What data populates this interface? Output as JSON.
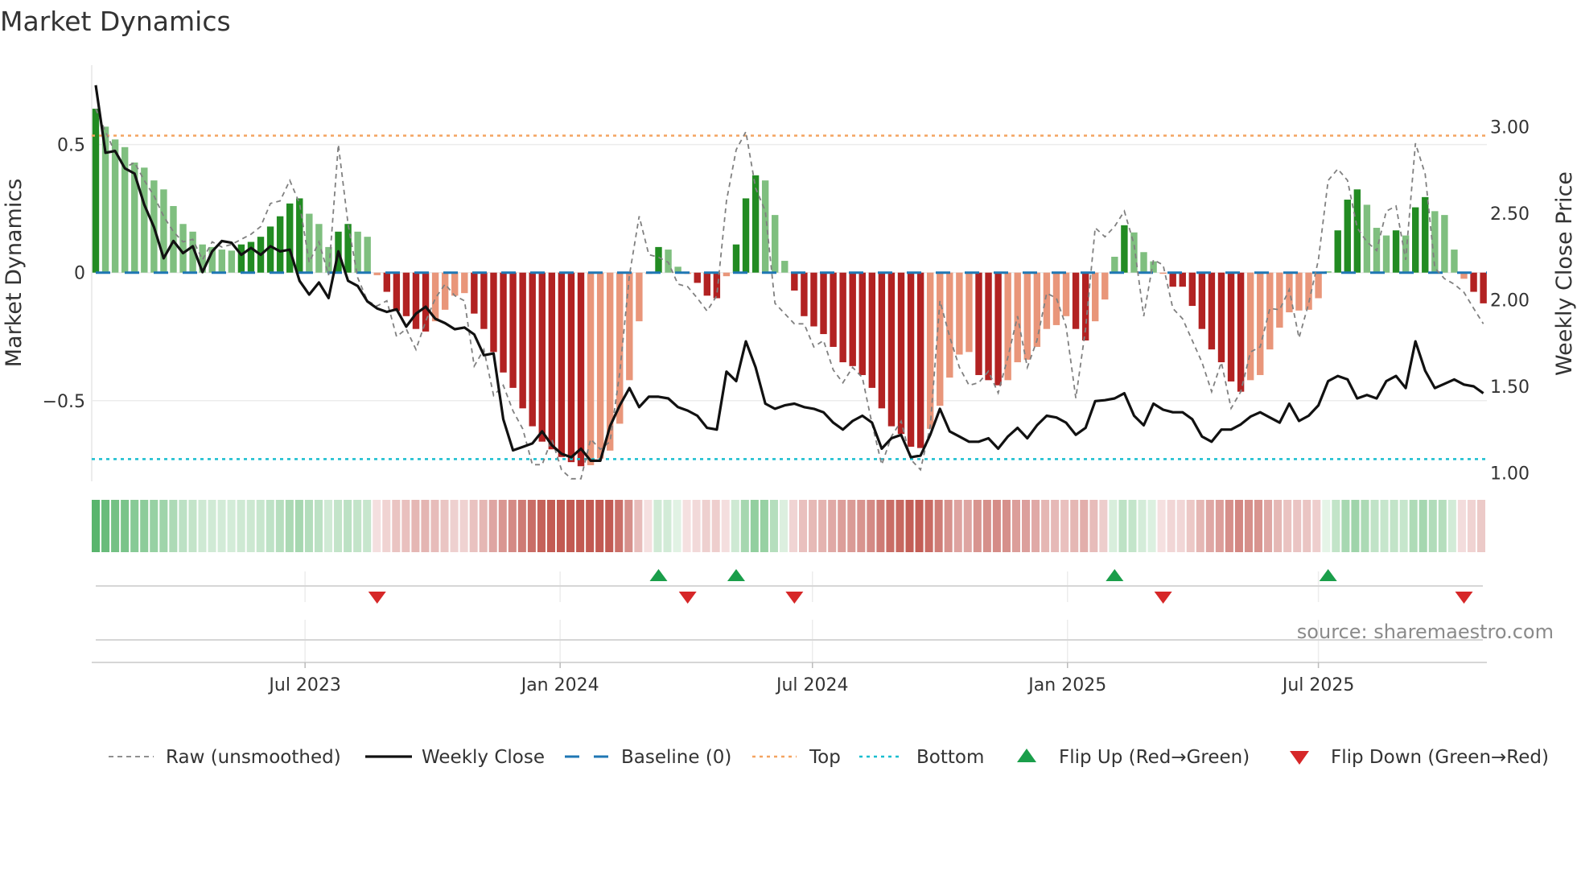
{
  "chart_data": {
    "type": "bar",
    "title": "Market Dynamics",
    "ylabel_left": "Market Dynamics",
    "ylabel_right": "Weekly Close Price",
    "start_week": "2023-01-31",
    "interval_days": 7,
    "ylim_left": [
      -0.815,
      0.81
    ],
    "ylim_right": [
      0.951,
      3.356
    ],
    "yticks_left": [
      {
        "value": 0.5,
        "label": "0.5"
      },
      {
        "value": 0,
        "label": "0"
      },
      {
        "value": -0.5,
        "label": "−0.5"
      }
    ],
    "yticks_right": [
      {
        "value": 3.0,
        "label": "3.00"
      },
      {
        "value": 2.5,
        "label": "2.50"
      },
      {
        "value": 2.0,
        "label": "2.00"
      },
      {
        "value": 1.5,
        "label": "1.50"
      },
      {
        "value": 1.0,
        "label": "1.00"
      }
    ],
    "xticks": [
      {
        "date": "2023-07-01",
        "label": "Jul 2023"
      },
      {
        "date": "2024-01-01",
        "label": "Jan 2024"
      },
      {
        "date": "2024-07-01",
        "label": "Jul 2024"
      },
      {
        "date": "2025-01-01",
        "label": "Jan 2025"
      },
      {
        "date": "2025-07-01",
        "label": "Jul 2025"
      }
    ],
    "top_level": 0.535,
    "bottom_level": -0.728,
    "baseline": 0,
    "grid": true,
    "legend_position": "bottom",
    "colors": {
      "green_strong": "#228b22",
      "green_fading": "#7fbf7f",
      "red_strong": "#b22222",
      "red_fading": "#e9967a",
      "raw": "#808080",
      "close": "#111111",
      "baseline": "#1f77b4",
      "top": "#f4a460",
      "bottom": "#17becf",
      "flip_up": "#1a9e4a",
      "flip_down": "#d62728"
    },
    "smoothed": [
      0.64,
      0.57,
      0.52,
      0.49,
      0.43,
      0.41,
      0.36,
      0.325,
      0.26,
      0.19,
      0.16,
      0.11,
      0.1,
      0.09,
      0.086,
      0.11,
      0.12,
      0.14,
      0.18,
      0.22,
      0.27,
      0.29,
      0.23,
      0.19,
      0.1,
      0.16,
      0.19,
      0.16,
      0.14,
      -0.01,
      -0.075,
      -0.15,
      -0.17,
      -0.22,
      -0.23,
      -0.19,
      -0.145,
      -0.09,
      -0.08,
      -0.16,
      -0.22,
      -0.31,
      -0.39,
      -0.45,
      -0.53,
      -0.6,
      -0.66,
      -0.69,
      -0.72,
      -0.74,
      -0.756,
      -0.752,
      -0.726,
      -0.695,
      -0.59,
      -0.42,
      -0.19,
      -0.005,
      0.1,
      0.09,
      0.023,
      -0.005,
      -0.04,
      -0.09,
      -0.1,
      -0.014,
      0.11,
      0.29,
      0.38,
      0.36,
      0.225,
      0.046,
      -0.07,
      -0.17,
      -0.21,
      -0.24,
      -0.29,
      -0.35,
      -0.365,
      -0.4,
      -0.45,
      -0.53,
      -0.6,
      -0.63,
      -0.68,
      -0.685,
      -0.61,
      -0.52,
      -0.41,
      -0.32,
      -0.31,
      -0.4,
      -0.42,
      -0.44,
      -0.42,
      -0.35,
      -0.34,
      -0.29,
      -0.22,
      -0.205,
      -0.17,
      -0.22,
      -0.265,
      -0.19,
      -0.105,
      0.062,
      0.185,
      0.157,
      0.08,
      0.044,
      -0.003,
      -0.055,
      -0.055,
      -0.13,
      -0.22,
      -0.3,
      -0.35,
      -0.425,
      -0.465,
      -0.42,
      -0.4,
      -0.3,
      -0.215,
      -0.155,
      -0.148,
      -0.145,
      -0.1,
      0.005,
      0.165,
      0.285,
      0.325,
      0.265,
      0.175,
      0.145,
      0.165,
      0.145,
      0.255,
      0.295,
      0.24,
      0.225,
      0.09,
      -0.024,
      -0.075,
      -0.12
    ],
    "raw": [
      0.64,
      0.55,
      0.47,
      0.41,
      0.43,
      0.36,
      0.3,
      0.22,
      0.16,
      0.12,
      0.13,
      0.05,
      0.12,
      0.1,
      0.11,
      0.13,
      0.15,
      0.18,
      0.27,
      0.28,
      0.36,
      0.27,
      0.04,
      0.12,
      -0.01,
      0.5,
      0.19,
      -0.02,
      -0.11,
      -0.13,
      -0.11,
      -0.25,
      -0.22,
      -0.3,
      -0.19,
      -0.1,
      -0.045,
      -0.09,
      -0.11,
      -0.365,
      -0.3,
      -0.48,
      -0.44,
      -0.54,
      -0.61,
      -0.75,
      -0.75,
      -0.65,
      -0.77,
      -0.805,
      -0.805,
      -0.65,
      -0.69,
      -0.66,
      -0.39,
      -0.01,
      0.22,
      0.07,
      0.06,
      0.04,
      -0.045,
      -0.055,
      -0.1,
      -0.15,
      -0.09,
      0.28,
      0.48,
      0.55,
      0.33,
      0.24,
      -0.12,
      -0.16,
      -0.2,
      -0.2,
      -0.29,
      -0.265,
      -0.38,
      -0.43,
      -0.37,
      -0.41,
      -0.59,
      -0.75,
      -0.64,
      -0.58,
      -0.73,
      -0.77,
      -0.6,
      -0.11,
      -0.25,
      -0.37,
      -0.44,
      -0.43,
      -0.385,
      -0.47,
      -0.33,
      -0.17,
      -0.37,
      -0.265,
      -0.08,
      -0.1,
      -0.21,
      -0.49,
      -0.22,
      0.175,
      0.14,
      0.18,
      0.24,
      0.11,
      -0.17,
      0.05,
      0.03,
      -0.14,
      -0.18,
      -0.265,
      -0.35,
      -0.465,
      -0.35,
      -0.53,
      -0.465,
      -0.31,
      -0.29,
      -0.14,
      -0.145,
      -0.066,
      -0.255,
      -0.12,
      0.05,
      0.36,
      0.405,
      0.36,
      0.175,
      0.12,
      0.086,
      0.24,
      0.26,
      0.05,
      0.505,
      0.385,
      0.018,
      -0.024,
      -0.045,
      -0.077,
      -0.14,
      -0.2
    ],
    "close": [
      3.24,
      2.85,
      2.86,
      2.76,
      2.73,
      2.55,
      2.42,
      2.24,
      2.34,
      2.27,
      2.31,
      2.16,
      2.28,
      2.34,
      2.33,
      2.26,
      2.3,
      2.26,
      2.31,
      2.28,
      2.29,
      2.11,
      2.03,
      2.1,
      2.01,
      2.28,
      2.11,
      2.08,
      1.99,
      1.95,
      1.93,
      1.945,
      1.845,
      1.92,
      1.96,
      1.89,
      1.865,
      1.83,
      1.84,
      1.8,
      1.68,
      1.69,
      1.31,
      1.13,
      1.15,
      1.17,
      1.24,
      1.16,
      1.11,
      1.09,
      1.14,
      1.07,
      1.07,
      1.27,
      1.39,
      1.49,
      1.38,
      1.44,
      1.44,
      1.43,
      1.38,
      1.36,
      1.33,
      1.26,
      1.25,
      1.585,
      1.53,
      1.76,
      1.61,
      1.4,
      1.37,
      1.39,
      1.4,
      1.38,
      1.37,
      1.35,
      1.29,
      1.25,
      1.3,
      1.33,
      1.29,
      1.14,
      1.2,
      1.22,
      1.09,
      1.1,
      1.22,
      1.37,
      1.24,
      1.21,
      1.18,
      1.18,
      1.2,
      1.14,
      1.21,
      1.26,
      1.2,
      1.275,
      1.33,
      1.32,
      1.29,
      1.22,
      1.26,
      1.415,
      1.42,
      1.43,
      1.46,
      1.33,
      1.275,
      1.4,
      1.365,
      1.35,
      1.35,
      1.31,
      1.21,
      1.18,
      1.25,
      1.25,
      1.28,
      1.325,
      1.35,
      1.32,
      1.29,
      1.4,
      1.3,
      1.33,
      1.39,
      1.53,
      1.56,
      1.54,
      1.43,
      1.45,
      1.43,
      1.53,
      1.56,
      1.49,
      1.76,
      1.59,
      1.49,
      1.515,
      1.54,
      1.51,
      1.5,
      1.46
    ],
    "source": "source: sharemaestro.com",
    "legend": [
      {
        "label": "Raw (unsmoothed)",
        "kind": "raw"
      },
      {
        "label": "Weekly Close",
        "kind": "close"
      },
      {
        "label": "Baseline (0)",
        "kind": "baseline"
      },
      {
        "label": "Top",
        "kind": "top"
      },
      {
        "label": "Bottom",
        "kind": "bottom"
      },
      {
        "label": "Flip Up (Red→Green)",
        "kind": "flip_up"
      },
      {
        "label": "Flip Down (Green→Red)",
        "kind": "flip_down"
      }
    ]
  }
}
